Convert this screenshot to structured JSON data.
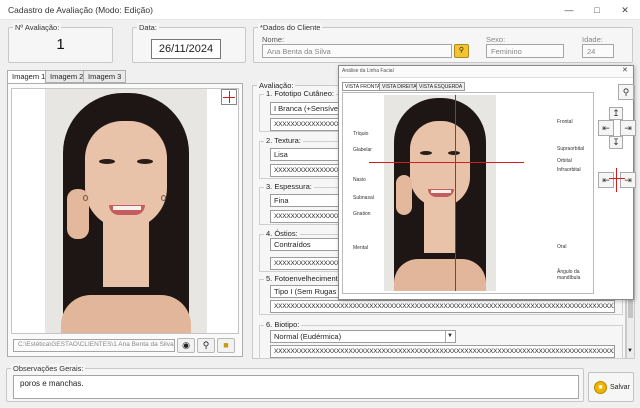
{
  "window": {
    "title": "Cadastro de Avaliação (Modo: Edição)"
  },
  "header": {
    "eval_number_label": "Nº Avaliação:",
    "eval_number": "1",
    "date_label": "Data:",
    "date_value": "26/11/2024",
    "client_group_label": "*Dados do Cliente",
    "name_label": "Nome:",
    "name_value": "Ana Benta da Silva",
    "sex_label": "Sexo:",
    "sex_value": "Feminino",
    "age_label": "Idade:",
    "age_value": "24"
  },
  "image_tabs": [
    {
      "label": "Imagem 1"
    },
    {
      "label": "Imagem 2"
    },
    {
      "label": "Imagem 3"
    }
  ],
  "image_path": "C:\\Estética\\GESTAO\\CLIENTES\\1 Ana Benta da Silva",
  "evaluation": {
    "label": "Avaliação:",
    "sections": [
      {
        "title": "1. Fototipo Cutâneo:",
        "value": "I Branca (+Sensível)",
        "text": "XXXXXXXXXXXXXXXXXX"
      },
      {
        "title": "2. Textura:",
        "value": "Lisa",
        "text": "XXXXXXXXXXXXXXXXXX"
      },
      {
        "title": "3. Espessura:",
        "value": "Fina",
        "text": "XXXXXXXXXXXXXXXXXX"
      },
      {
        "title": "4. Óstios:",
        "value": "Contraídos",
        "text": "XXXXXXXXXXXXXXXXXX"
      },
      {
        "title": "5. Fotoenvelhecimento",
        "value": "Tipo I (Sem Rugas 2",
        "text": "XXXXXXXXXXXXXXXXXXXXXXXXXXXXXXXXXXXXXXXXXXXXXXXXXXXXXXXXXXXXXXXXXXXXXXXXXXXXXXXXXXX"
      },
      {
        "title": "6. Biotipo:",
        "value": "Normal (Eudérmica)",
        "text": "XXXXXXXXXXXXXXXXXXXXXXXXXXXXXXXXXXXXXXXXXXXXXXXXXXXXXXXXXXXXXXXXXXXXXXXXXXXXXXXXXXX"
      }
    ]
  },
  "popup": {
    "title": "Análise da Linha Facial",
    "tabs": [
      {
        "label": "VISTA FRONTAL"
      },
      {
        "label": "VISTA DIREITA"
      },
      {
        "label": "VISTA ESQUERDA"
      }
    ],
    "left_markers": [
      "Tríquio",
      "Glabelar",
      "Nasio",
      "Subnasal",
      "Gnation",
      "Mental"
    ],
    "right_markers": [
      "Frontal",
      "Supraorbital",
      "Orbital",
      "Infraorbital",
      "Oral",
      "Ângulo da mandíbula"
    ],
    "accent": "#d21d1d"
  },
  "observations": {
    "label": "Observações Gerais:",
    "value": "poros e manchas."
  },
  "save": {
    "label": "Salvar"
  }
}
